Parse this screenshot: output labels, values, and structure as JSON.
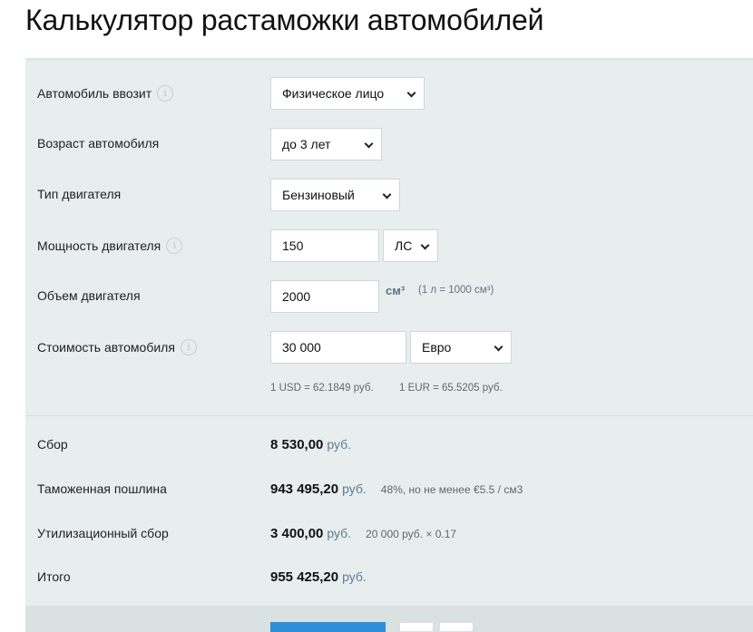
{
  "title": "Калькулятор растаможки автомобилей",
  "form": {
    "importer": {
      "label": "Автомобиль ввозит",
      "value": "Физическое лицо"
    },
    "age": {
      "label": "Возраст автомобиля",
      "value": "до 3 лет"
    },
    "engine_type": {
      "label": "Тип двигателя",
      "value": "Бензиновый"
    },
    "power": {
      "label": "Мощность двигателя",
      "value": "150",
      "unit": "ЛС"
    },
    "volume": {
      "label": "Объем двигателя",
      "value": "2000",
      "unit": "см³",
      "hint": "(1 л = 1000 см³)"
    },
    "price": {
      "label": "Стоимость автомобиля",
      "value": "30 000",
      "currency": "Евро"
    },
    "rates": {
      "usd": "1 USD = 62.1849 руб.",
      "eur": "1 EUR = 65.5205 руб."
    }
  },
  "results": [
    {
      "label": "Сбор",
      "value": "8 530,00",
      "unit": "руб.",
      "note": ""
    },
    {
      "label": "Таможенная пошлина",
      "value": "943 495,20",
      "unit": "руб.",
      "note": "48%, но не менее €5.5 / см3"
    },
    {
      "label": "Утилизационный сбор",
      "value": "3 400,00",
      "unit": "руб.",
      "note": "20 000 руб. × 0.17"
    },
    {
      "label": "Итого",
      "value": "955 425,20",
      "unit": "руб.",
      "note": ""
    }
  ],
  "info_icon": "i"
}
